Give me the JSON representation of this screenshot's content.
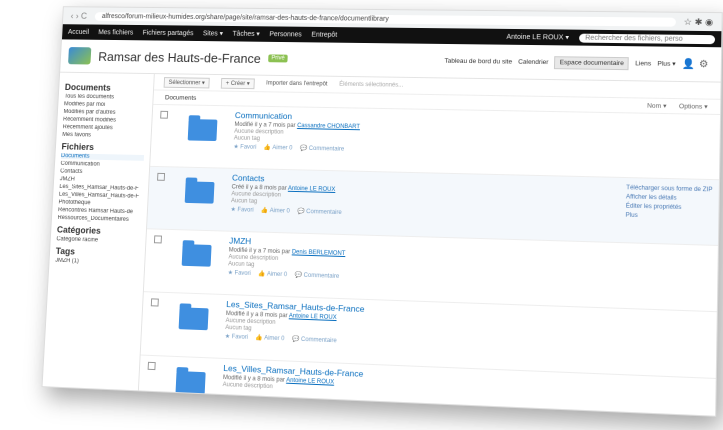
{
  "browser": {
    "nav": "‹ › C",
    "url": "alfresco/forum-milieux-humides.org/share/page/site/ramsar-des-hauts-de-france/documentlibrary"
  },
  "topbar": {
    "items": [
      "Accueil",
      "Mes fichiers",
      "Fichiers partagés",
      "Sites ▾",
      "Tâches ▾",
      "Personnes",
      "Entrepôt"
    ],
    "user": "Antoine LE ROUX ▾",
    "search_placeholder": "Rechercher des fichiers, perso"
  },
  "site": {
    "title": "Ramsar des Hauts-de-France",
    "badge": "Privé",
    "nav": [
      "Tableau de bord du site",
      "Calendrier",
      "Espace documentaire",
      "Liens",
      "Plus ▾"
    ]
  },
  "sidebar": {
    "documents_title": "Documents",
    "documents": [
      "Tous les documents",
      "Modifiés par moi",
      "Modifiés par d'autres",
      "Récemment modifiés",
      "Récemment ajoutés",
      "Mes favoris"
    ],
    "files_title": "Fichiers",
    "folders": [
      "Documents",
      "Communication",
      "Contacts",
      "JMZH",
      "Les_Sites_Ramsar_Hauts-de-F",
      "Les_Villes_Ramsar_Hauts-de-F",
      "Photothèque",
      "Rencontres Ramsar Hauts-de",
      "Ressources_Documentaires"
    ],
    "categories_title": "Catégories",
    "categories": [
      "Catégorie racine"
    ],
    "tags_title": "Tags",
    "tags": [
      "JMZH (1)"
    ]
  },
  "toolbar": {
    "select": "Sélectionner ▾",
    "create": "+ Créer ▾",
    "import": "Importer dans l'entrepôt",
    "selected": "Éléments sélectionnés..."
  },
  "list_header": {
    "title": "Documents",
    "sort": "Nom ▾",
    "options": "Options ▾"
  },
  "rows": [
    {
      "name": "Communication",
      "meta": "Modifié il y a 7 mois par",
      "user": "Cassandre CHONBART",
      "desc": "Aucune description",
      "tags": "Aucun tag",
      "actions": [
        "★ Favori",
        "👍 Aimer 0",
        "💬 Commentaire"
      ]
    },
    {
      "name": "Contacts",
      "meta": "Créé il y a 8 mois par",
      "user": "Antoine LE ROUX",
      "desc": "Aucune description",
      "tags": "Aucun tag",
      "actions": [
        "★ Favori",
        "👍 Aimer 0",
        "💬 Commentaire"
      ]
    },
    {
      "name": "JMZH",
      "meta": "Modifié il y a 7 mois par",
      "user": "Denis BERLEMONT",
      "desc": "Aucune description",
      "tags": "Aucun tag",
      "actions": [
        "★ Favori",
        "👍 Aimer 0",
        "💬 Commentaire"
      ]
    },
    {
      "name": "Les_Sites_Ramsar_Hauts-de-France",
      "meta": "Modifié il y a 8 mois par",
      "user": "Antoine LE ROUX",
      "desc": "Aucune description",
      "tags": "Aucun tag",
      "actions": [
        "★ Favori",
        "👍 Aimer 0",
        "💬 Commentaire"
      ]
    },
    {
      "name": "Les_Villes_Ramsar_Hauts-de-France",
      "meta": "Modifié il y a 8 mois par",
      "user": "Antoine LE ROUX",
      "desc": "Aucune description",
      "tags": "",
      "actions": []
    }
  ],
  "row_actions": [
    "Télécharger sous forme de ZIP",
    "Afficher les détails",
    "Éditer les propriétés",
    "Plus"
  ]
}
